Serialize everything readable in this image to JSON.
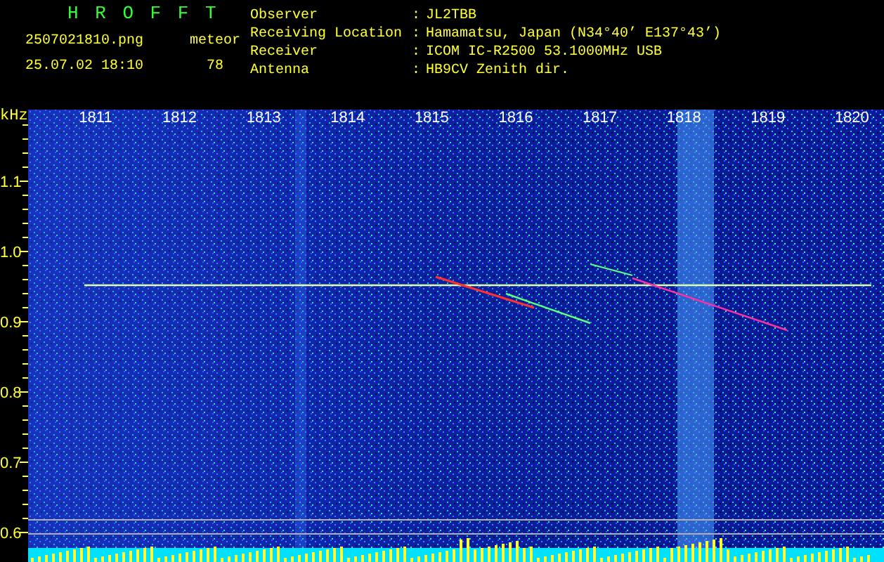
{
  "app": {
    "title": "H R O F F T"
  },
  "file": "2507021810.png",
  "timestamp": "25.07.02 18:10",
  "mode_label": "meteor",
  "count": "78",
  "info": [
    {
      "label": "Observer",
      "separator": ":",
      "value": "JL2TBB"
    },
    {
      "label": "Receiving Location",
      "separator": ":",
      "value": "Hamamatsu, Japan (N34°40’ E137°43’)"
    },
    {
      "label": "Receiver",
      "separator": ":",
      "value": "ICOM IC-R2500 53.1000MHz USB"
    },
    {
      "label": "Antenna",
      "separator": ":",
      "value": "HB9CV Zenith dir."
    }
  ],
  "axis": {
    "unit": "kHz",
    "x_ticks": [
      "1811",
      "1812",
      "1813",
      "1814",
      "1815",
      "1816",
      "1817",
      "1818",
      "1819",
      "1820"
    ],
    "y_ticks": [
      "1.1",
      "1.0",
      "0.9",
      "0.8",
      "0.7",
      "0.6"
    ]
  }
}
